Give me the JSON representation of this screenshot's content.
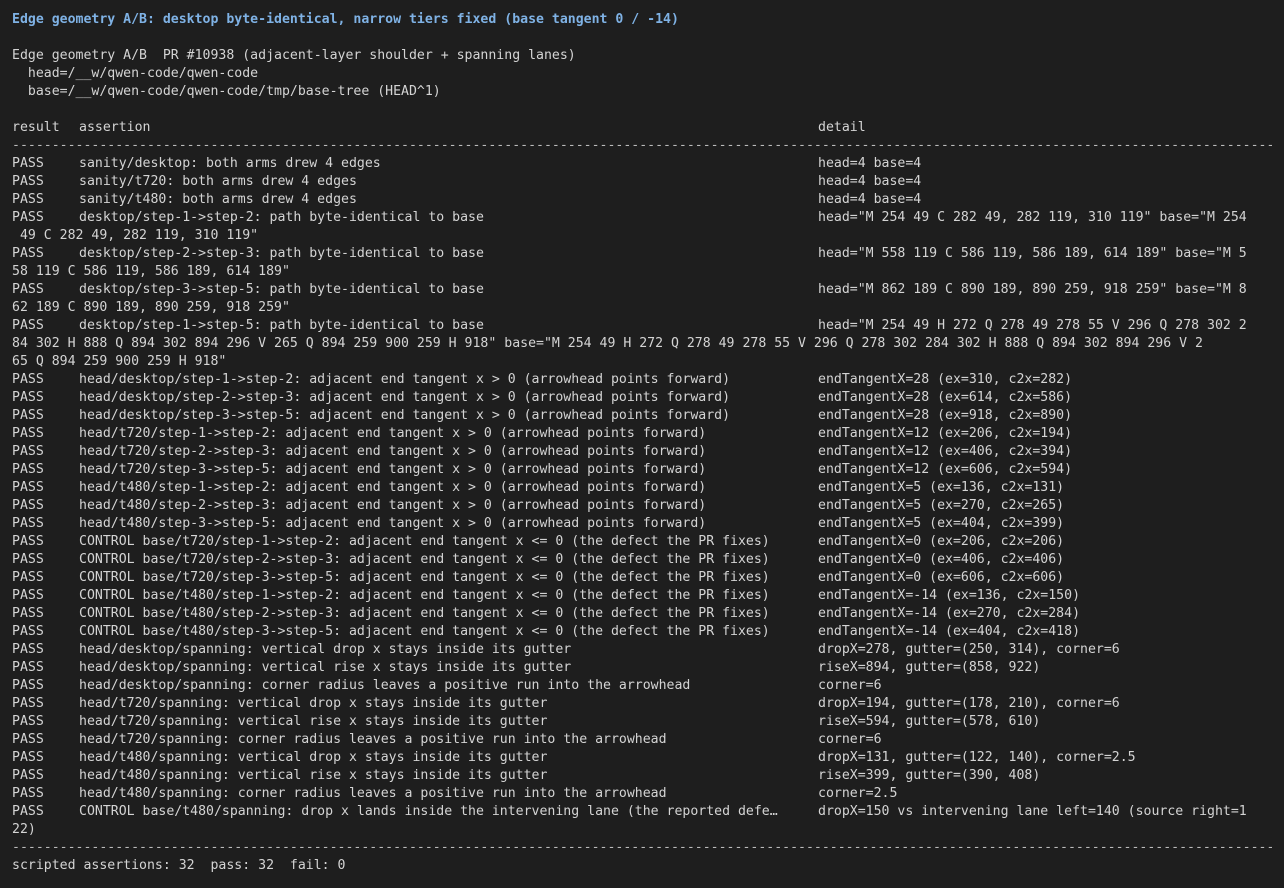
{
  "title": "Edge geometry A/B: desktop byte-identical, narrow tiers fixed (base tangent 0 / -14)",
  "meta": [
    "Edge geometry A/B  PR #10938 (adjacent-layer shoulder + spanning lanes)",
    "  head=/__w/qwen-code/qwen-code",
    "  base=/__w/qwen-code/qwen-code/tmp/base-tree (HEAD^1)"
  ],
  "columns": {
    "result": "result",
    "assertion": "assertion",
    "detail": "detail"
  },
  "rule": "-----------------------------------------------------------------------------------------------------------------------------------------------------------------------------------------------------------------------------------------------",
  "rows": [
    {
      "result": "PASS",
      "assertion": "sanity/desktop: both arms drew 4 edges",
      "detail": "head=4 base=4",
      "wrap": ""
    },
    {
      "result": "PASS",
      "assertion": "sanity/t720: both arms drew 4 edges",
      "detail": "head=4 base=4",
      "wrap": ""
    },
    {
      "result": "PASS",
      "assertion": "sanity/t480: both arms drew 4 edges",
      "detail": "head=4 base=4",
      "wrap": ""
    },
    {
      "result": "PASS",
      "assertion": "desktop/step-1->step-2: path byte-identical to base",
      "detail": "head=\"M 254 49 C 282 49, 282 119, 310 119\" base=\"M 254",
      "wrap": " 49 C 282 49, 282 119, 310 119\""
    },
    {
      "result": "PASS",
      "assertion": "desktop/step-2->step-3: path byte-identical to base",
      "detail": "head=\"M 558 119 C 586 119, 586 189, 614 189\" base=\"M 5",
      "wrap": "58 119 C 586 119, 586 189, 614 189\""
    },
    {
      "result": "PASS",
      "assertion": "desktop/step-3->step-5: path byte-identical to base",
      "detail": "head=\"M 862 189 C 890 189, 890 259, 918 259\" base=\"M 8",
      "wrap": "62 189 C 890 189, 890 259, 918 259\""
    },
    {
      "result": "PASS",
      "assertion": "desktop/step-1->step-5: path byte-identical to base",
      "detail": "head=\"M 254 49 H 272 Q 278 49 278 55 V 296 Q 278 302 2",
      "wrap": "84 302 H 888 Q 894 302 894 296 V 265 Q 894 259 900 259 H 918\" base=\"M 254 49 H 272 Q 278 49 278 55 V 296 Q 278 302 284 302 H 888 Q 894 302 894 296 V 2",
      "wrap2": "65 Q 894 259 900 259 H 918\""
    },
    {
      "result": "PASS",
      "assertion": "head/desktop/step-1->step-2: adjacent end tangent x > 0 (arrowhead points forward)",
      "detail": "endTangentX=28 (ex=310, c2x=282)",
      "wrap": ""
    },
    {
      "result": "PASS",
      "assertion": "head/desktop/step-2->step-3: adjacent end tangent x > 0 (arrowhead points forward)",
      "detail": "endTangentX=28 (ex=614, c2x=586)",
      "wrap": ""
    },
    {
      "result": "PASS",
      "assertion": "head/desktop/step-3->step-5: adjacent end tangent x > 0 (arrowhead points forward)",
      "detail": "endTangentX=28 (ex=918, c2x=890)",
      "wrap": ""
    },
    {
      "result": "PASS",
      "assertion": "head/t720/step-1->step-2: adjacent end tangent x > 0 (arrowhead points forward)",
      "detail": "endTangentX=12 (ex=206, c2x=194)",
      "wrap": ""
    },
    {
      "result": "PASS",
      "assertion": "head/t720/step-2->step-3: adjacent end tangent x > 0 (arrowhead points forward)",
      "detail": "endTangentX=12 (ex=406, c2x=394)",
      "wrap": ""
    },
    {
      "result": "PASS",
      "assertion": "head/t720/step-3->step-5: adjacent end tangent x > 0 (arrowhead points forward)",
      "detail": "endTangentX=12 (ex=606, c2x=594)",
      "wrap": ""
    },
    {
      "result": "PASS",
      "assertion": "head/t480/step-1->step-2: adjacent end tangent x > 0 (arrowhead points forward)",
      "detail": "endTangentX=5 (ex=136, c2x=131)",
      "wrap": ""
    },
    {
      "result": "PASS",
      "assertion": "head/t480/step-2->step-3: adjacent end tangent x > 0 (arrowhead points forward)",
      "detail": "endTangentX=5 (ex=270, c2x=265)",
      "wrap": ""
    },
    {
      "result": "PASS",
      "assertion": "head/t480/step-3->step-5: adjacent end tangent x > 0 (arrowhead points forward)",
      "detail": "endTangentX=5 (ex=404, c2x=399)",
      "wrap": ""
    },
    {
      "result": "PASS",
      "assertion": "CONTROL base/t720/step-1->step-2: adjacent end tangent x <= 0 (the defect the PR fixes)",
      "detail": "endTangentX=0 (ex=206, c2x=206)",
      "wrap": ""
    },
    {
      "result": "PASS",
      "assertion": "CONTROL base/t720/step-2->step-3: adjacent end tangent x <= 0 (the defect the PR fixes)",
      "detail": "endTangentX=0 (ex=406, c2x=406)",
      "wrap": ""
    },
    {
      "result": "PASS",
      "assertion": "CONTROL base/t720/step-3->step-5: adjacent end tangent x <= 0 (the defect the PR fixes)",
      "detail": "endTangentX=0 (ex=606, c2x=606)",
      "wrap": ""
    },
    {
      "result": "PASS",
      "assertion": "CONTROL base/t480/step-1->step-2: adjacent end tangent x <= 0 (the defect the PR fixes)",
      "detail": "endTangentX=-14 (ex=136, c2x=150)",
      "wrap": ""
    },
    {
      "result": "PASS",
      "assertion": "CONTROL base/t480/step-2->step-3: adjacent end tangent x <= 0 (the defect the PR fixes)",
      "detail": "endTangentX=-14 (ex=270, c2x=284)",
      "wrap": ""
    },
    {
      "result": "PASS",
      "assertion": "CONTROL base/t480/step-3->step-5: adjacent end tangent x <= 0 (the defect the PR fixes)",
      "detail": "endTangentX=-14 (ex=404, c2x=418)",
      "wrap": ""
    },
    {
      "result": "PASS",
      "assertion": "head/desktop/spanning: vertical drop x stays inside its gutter",
      "detail": "dropX=278, gutter=(250, 314), corner=6",
      "wrap": ""
    },
    {
      "result": "PASS",
      "assertion": "head/desktop/spanning: vertical rise x stays inside its gutter",
      "detail": "riseX=894, gutter=(858, 922)",
      "wrap": ""
    },
    {
      "result": "PASS",
      "assertion": "head/desktop/spanning: corner radius leaves a positive run into the arrowhead",
      "detail": "corner=6",
      "wrap": ""
    },
    {
      "result": "PASS",
      "assertion": "head/t720/spanning: vertical drop x stays inside its gutter",
      "detail": "dropX=194, gutter=(178, 210), corner=6",
      "wrap": ""
    },
    {
      "result": "PASS",
      "assertion": "head/t720/spanning: vertical rise x stays inside its gutter",
      "detail": "riseX=594, gutter=(578, 610)",
      "wrap": ""
    },
    {
      "result": "PASS",
      "assertion": "head/t720/spanning: corner radius leaves a positive run into the arrowhead",
      "detail": "corner=6",
      "wrap": ""
    },
    {
      "result": "PASS",
      "assertion": "head/t480/spanning: vertical drop x stays inside its gutter",
      "detail": "dropX=131, gutter=(122, 140), corner=2.5",
      "wrap": ""
    },
    {
      "result": "PASS",
      "assertion": "head/t480/spanning: vertical rise x stays inside its gutter",
      "detail": "riseX=399, gutter=(390, 408)",
      "wrap": ""
    },
    {
      "result": "PASS",
      "assertion": "head/t480/spanning: corner radius leaves a positive run into the arrowhead",
      "detail": "corner=2.5",
      "wrap": ""
    },
    {
      "result": "PASS",
      "assertion": "CONTROL base/t480/spanning: drop x lands inside the intervening lane (the reported defe…",
      "detail": "dropX=150 vs intervening lane left=140 (source right=1",
      "wrap": "22)"
    }
  ],
  "summary": "scripted assertions: 32  pass: 32  fail: 0"
}
